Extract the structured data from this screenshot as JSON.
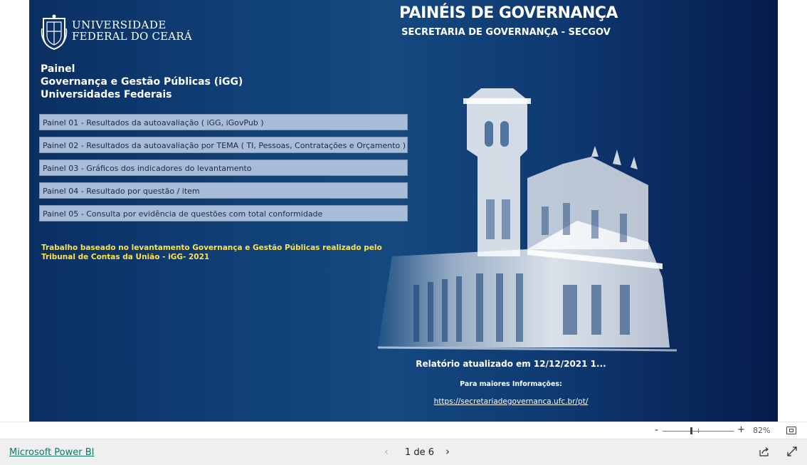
{
  "report": {
    "logo": {
      "line1": "UNIVERSIDADE",
      "line2": "FEDERAL DO CEARÁ"
    },
    "title": "PAINÉIS DE GOVERNANÇA",
    "subtitle": "SECRETARIA DE GOVERNANÇA - SECGOV",
    "heading": [
      "Painel",
      "Governança e Gestão Públicas (iGG)",
      "Universidades Federais"
    ],
    "panels": [
      "Painel 01 - Resultados da autoavaliação ( iGG, iGovPub )",
      "Painel 02 - Resultados da autoavaliação por TEMA ( TI, Pessoas, Contratações e Orçamento )",
      "Painel 03 - Gráficos dos indicadores do levantamento",
      "Painel 04 - Resultado por questão / item",
      "Painel 05 - Consulta por evidência de questões com total conformidade"
    ],
    "note": "Trabalho baseado no levantamento Governança e Gestão Públicas realizado pelo Tribunal de Contas da União - iGG- 2021",
    "updated": "Relatório atualizado em 12/12/2021 1...",
    "more_info": "Para maiores Informações:",
    "link": "https://secretariadegovernanca.ufc.br/pt/"
  },
  "zoom": {
    "minus": "-",
    "plus": "+",
    "percent": "82%",
    "level": 0.4
  },
  "footer": {
    "brand": "Microsoft Power BI",
    "page": "1 de 6",
    "prev": "‹",
    "next": "›"
  },
  "icons": {
    "logo": "ufc-crest-icon",
    "share": "share-icon",
    "expand": "expand-icon",
    "fit": "fit-to-page-icon"
  }
}
